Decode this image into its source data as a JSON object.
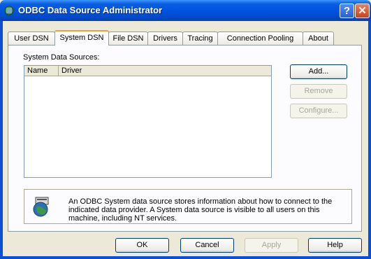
{
  "window": {
    "title": "ODBC Data Source Administrator",
    "help_glyph": "?",
    "close_glyph": "✕"
  },
  "tabs": [
    "User DSN",
    "System DSN",
    "File DSN",
    "Drivers",
    "Tracing",
    "Connection Pooling",
    "About"
  ],
  "active_tab": "System DSN",
  "system_dsn": {
    "group_label": "System Data Sources:",
    "columns": [
      "Name",
      "Driver"
    ],
    "rows": [],
    "add_label": "Add...",
    "remove_label": "Remove",
    "configure_label": "Configure...",
    "info_text": "An ODBC System data source stores information about how to connect to the indicated data provider.   A System data source is visible to all users on this machine, including NT services."
  },
  "footer": {
    "ok_label": "OK",
    "cancel_label": "Cancel",
    "apply_label": "Apply",
    "help_label": "Help"
  },
  "colors": {
    "titlebar": "#0053e1",
    "face": "#ece9d8",
    "tab_highlight": "#e7a53e"
  }
}
